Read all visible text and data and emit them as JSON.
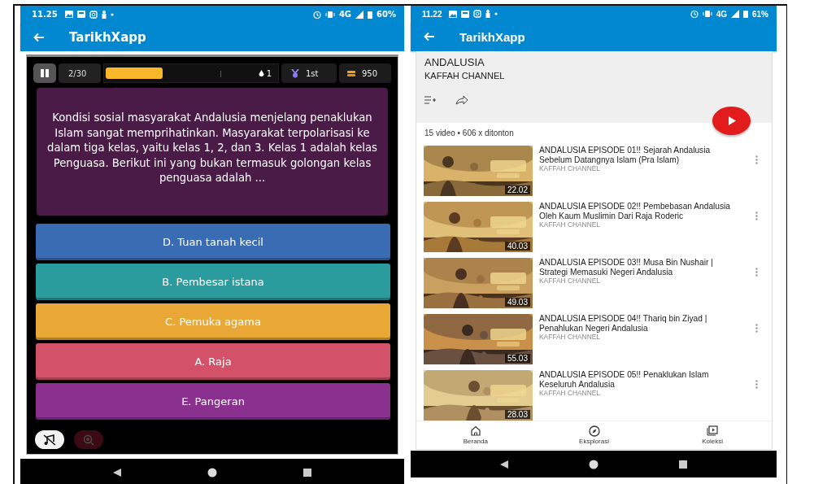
{
  "quiz_phone": {
    "status_bar": {
      "time": "11.25",
      "network": "4G",
      "battery": "60%"
    },
    "app_bar": {
      "title": "TarikhXapp"
    },
    "top_bar": {
      "counter": "2/30",
      "progress": {
        "level": 0.33
      },
      "lives": "1",
      "rank": "1st",
      "coins": "950"
    },
    "question": "Kondisi sosial masyarakat Andalusia menjelang penaklukan Islam sangat memprihatinkan. Masyarakat terpolarisasi ke dalam tiga kelas, yaitu kelas 1, 2, dan 3. Kelas 1 adalah kelas Penguasa. Berikut ini yang bukan termasuk golongan kelas penguasa adalah ...",
    "answers": [
      {
        "label": "D. Tuan tanah kecil",
        "color": "#3a6cb3"
      },
      {
        "label": "B. Pembesar istana",
        "color": "#2a9c9e"
      },
      {
        "label": "C. Pemuka agama",
        "color": "#e9a736"
      },
      {
        "label": "A. Raja",
        "color": "#d4516a"
      },
      {
        "label": "E. Pangeran",
        "color": "#8a3190"
      }
    ],
    "tools": [
      {
        "kind": "sound",
        "disabled": false
      },
      {
        "kind": "zoom",
        "disabled": true
      }
    ]
  },
  "playlist_phone": {
    "status_bar": {
      "time": "11.22",
      "network": "4G",
      "battery": "61%"
    },
    "app_bar": {
      "title": "TarikhXapp"
    },
    "playlist": {
      "title": "ANDALUSIA",
      "channel": "KAFFAH CHANNEL",
      "stats": "15 video • 606 x ditonton"
    },
    "videos": [
      {
        "title": "ANDALUSIA EPISODE 01!! Sejarah Andalusia Sebelum Datangnya Islam (Pra Islam)",
        "channel": "KAFFAH CHANNEL",
        "duration": "22.02"
      },
      {
        "title": "ANDALUSIA EPISODE 02!! Pembebasan Andalusia Oleh Kaum Muslimin Dari Raja Roderic",
        "channel": "KAFFAH CHANNEL",
        "duration": "40.03"
      },
      {
        "title": "ANDALUSIA EPISODE 03!! Musa Bin Nushair | Strategi Memasuki Negeri Andalusia",
        "channel": "KAFFAH CHANNEL",
        "duration": "49.03"
      },
      {
        "title": "ANDALUSIA EPISODE 04!! Thariq bin Ziyad | Penahlukan Negeri Andalusia",
        "channel": "KAFFAH CHANNEL",
        "duration": "55.03"
      },
      {
        "title": "ANDALUSIA EPISODE 05!! Penaklukan Islam Keseluruh Andalusia",
        "channel": "KAFFAH CHANNEL",
        "duration": "28.03"
      }
    ],
    "bottom_nav": [
      {
        "label": "Beranda",
        "kind": "home",
        "selected": false
      },
      {
        "label": "Eksplorasi",
        "kind": "explore",
        "selected": false
      },
      {
        "label": "Koleksi",
        "kind": "library",
        "selected": false
      }
    ]
  }
}
